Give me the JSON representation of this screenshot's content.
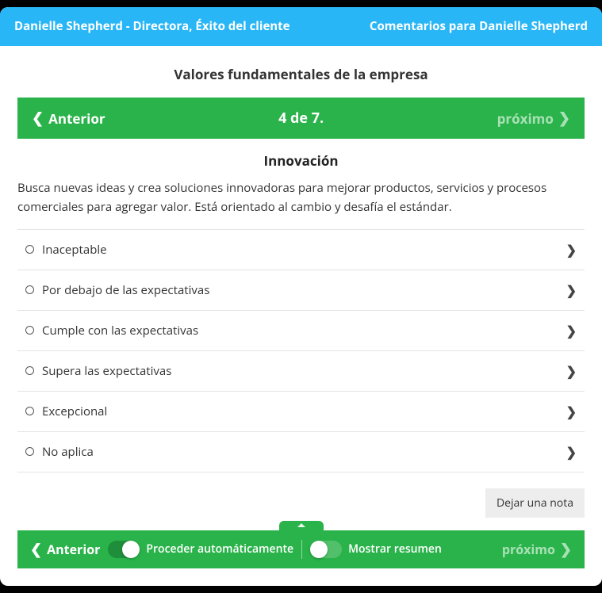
{
  "header": {
    "person_line": "Danielle Shepherd - Directora, Éxito del cliente",
    "context_line": "Comentarios para Danielle Shepherd"
  },
  "section_title": "Valores fundamentales de la empresa",
  "nav": {
    "prev_label": "Anterior",
    "position": "4 de 7.",
    "next_label": "próximo"
  },
  "competency": {
    "title": "Innovación",
    "description": "Busca nuevas ideas y crea soluciones innovadoras para mejorar productos, servicios y procesos comerciales para agregar valor. Está orientado al cambio y desafía el estándar."
  },
  "options": [
    {
      "label": "Inaceptable"
    },
    {
      "label": "Por debajo de las expectativas"
    },
    {
      "label": "Cumple con las expectativas"
    },
    {
      "label": "Supera las expectativas"
    },
    {
      "label": "Excepcional"
    },
    {
      "label": "No aplica"
    }
  ],
  "note_button": "Dejar una nota",
  "footer": {
    "prev_label": "Anterior",
    "auto_proceed_label": "Proceder automáticamente",
    "auto_proceed_on": true,
    "show_summary_label": "Mostrar resumen",
    "show_summary_on": false,
    "next_label": "próximo"
  }
}
